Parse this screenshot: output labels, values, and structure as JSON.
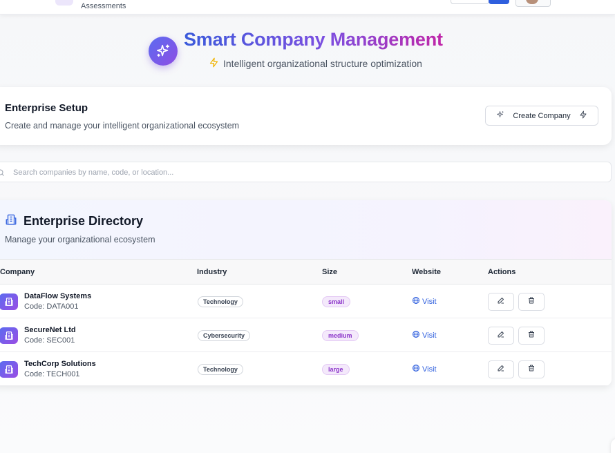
{
  "topbar": {
    "subtitle": "Assessments"
  },
  "hero": {
    "title": "Smart Company Management",
    "subtitle": "Intelligent organizational structure optimization"
  },
  "setup": {
    "title": "Enterprise Setup",
    "description": "Create and manage your intelligent organizational ecosystem",
    "create_button": "Create Company"
  },
  "search": {
    "placeholder": "Search companies by name, code, or location...",
    "value": ""
  },
  "directory": {
    "title": "Enterprise Directory",
    "description": "Manage your organizational ecosystem",
    "columns": {
      "company": "Company",
      "industry": "Industry",
      "size": "Size",
      "website": "Website",
      "actions": "Actions"
    },
    "rows": [
      {
        "name": "DataFlow Systems",
        "code": "Code: DATA001",
        "industry": "Technology",
        "size": "small",
        "website": "Visit"
      },
      {
        "name": "SecureNet Ltd",
        "code": "Code: SEC001",
        "industry": "Cybersecurity",
        "size": "medium",
        "website": "Visit"
      },
      {
        "name": "TechCorp Solutions",
        "code": "Code: TECH001",
        "industry": "Technology",
        "size": "large",
        "website": "Visit"
      }
    ]
  },
  "colors": {
    "accent_blue": "#2f5fde",
    "accent_purple": "#8e4de4",
    "size_badge_text": "#8b34c9",
    "lightning": "#f0b400"
  },
  "icons": {
    "hero": "sparkles-icon",
    "subtitle": "lightning-icon",
    "create": "sparkles-icon",
    "create_trailing": "lightning-icon",
    "search": "search-icon",
    "directory": "building-icon",
    "company": "building-icon",
    "website": "globe-icon",
    "edit": "pencil-icon",
    "delete": "trash-icon"
  }
}
